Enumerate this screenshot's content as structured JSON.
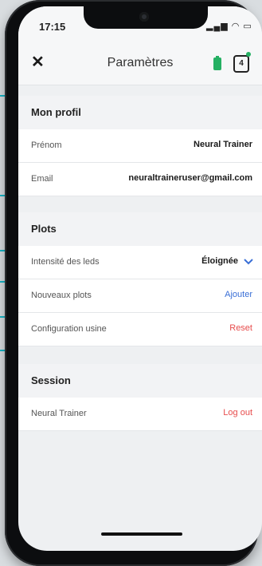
{
  "status_bar": {
    "time": "17:15",
    "icons": "signal-wifi-battery"
  },
  "nav": {
    "title": "Paramètres",
    "close_symbol": "✕",
    "device_number": "4"
  },
  "profile": {
    "title": "Mon profil",
    "first_name_label": "Prénom",
    "first_name_value": "Neural Trainer",
    "email_label": "Email",
    "email_value": "neuraltraineruser@gmail.com"
  },
  "plots": {
    "title": "Plots",
    "led_label": "Intensité des leds",
    "led_value": "Éloignée",
    "new_plots_label": "Nouveaux plots",
    "new_plots_action": "Ajouter",
    "factory_label": "Configuration usine",
    "factory_action": "Reset"
  },
  "session": {
    "title": "Session",
    "user_label": "Neural Trainer",
    "logout_action": "Log out"
  },
  "colors": {
    "accent_blue": "#3a6fd6",
    "danger_red": "#e74c4c",
    "battery_green": "#25b063",
    "pointer_teal": "#17b7c8"
  }
}
